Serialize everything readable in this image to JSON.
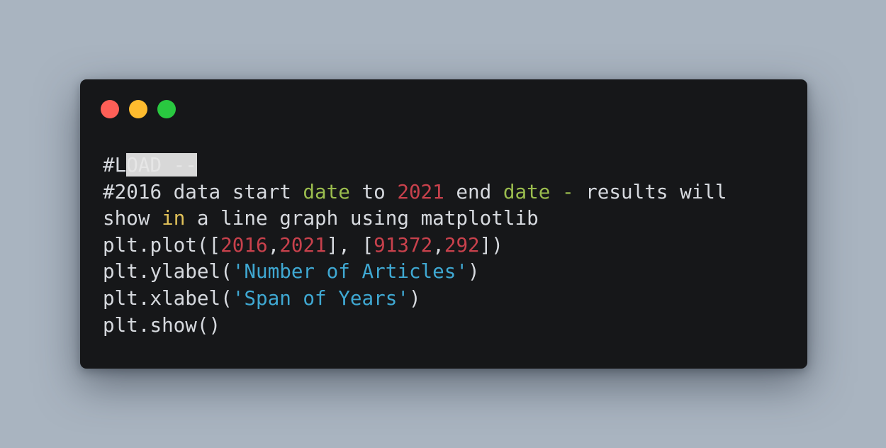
{
  "colors": {
    "page_background": "#a9b4c0",
    "window_background": "#161719",
    "plain_text": "#d6d9de",
    "number": "#c8414c",
    "string": "#3fa8d2",
    "keyword_green": "#9bbd4e",
    "keyword_yellow": "#e2c25a",
    "selection": "#d8d8d8"
  },
  "window": {
    "controls": [
      {
        "name": "close",
        "color": "#fe5f57"
      },
      {
        "name": "minimize",
        "color": "#febb2e"
      },
      {
        "name": "zoom",
        "color": "#29c840"
      }
    ]
  },
  "code": {
    "lines": [
      [
        {
          "text": "#L",
          "style": "plain"
        },
        {
          "text": "OAD --",
          "style": "sel"
        }
      ],
      [
        {
          "text": "#2016 data start ",
          "style": "plain"
        },
        {
          "text": "date",
          "style": "kw"
        },
        {
          "text": " to ",
          "style": "plain"
        },
        {
          "text": "2021",
          "style": "num"
        },
        {
          "text": " end ",
          "style": "plain"
        },
        {
          "text": "date",
          "style": "kw"
        },
        {
          "text": " ",
          "style": "plain"
        },
        {
          "text": "-",
          "style": "kw"
        },
        {
          "text": " results will",
          "style": "plain"
        }
      ],
      [
        {
          "text": "show ",
          "style": "plain"
        },
        {
          "text": "in",
          "style": "yellow"
        },
        {
          "text": " a line graph using matplotlib",
          "style": "plain"
        }
      ],
      [
        {
          "text": "plt.plot([",
          "style": "plain"
        },
        {
          "text": "2016",
          "style": "num"
        },
        {
          "text": ",",
          "style": "plain"
        },
        {
          "text": "2021",
          "style": "num"
        },
        {
          "text": "], [",
          "style": "plain"
        },
        {
          "text": "91372",
          "style": "num"
        },
        {
          "text": ",",
          "style": "plain"
        },
        {
          "text": "292",
          "style": "num"
        },
        {
          "text": "])",
          "style": "plain"
        }
      ],
      [
        {
          "text": "plt.ylabel(",
          "style": "plain"
        },
        {
          "text": "'Number of Articles'",
          "style": "str"
        },
        {
          "text": ")",
          "style": "plain"
        }
      ],
      [
        {
          "text": "plt.xlabel(",
          "style": "plain"
        },
        {
          "text": "'Span of Years'",
          "style": "str"
        },
        {
          "text": ")",
          "style": "plain"
        }
      ],
      [
        {
          "text": "plt.show()",
          "style": "plain"
        }
      ]
    ]
  }
}
